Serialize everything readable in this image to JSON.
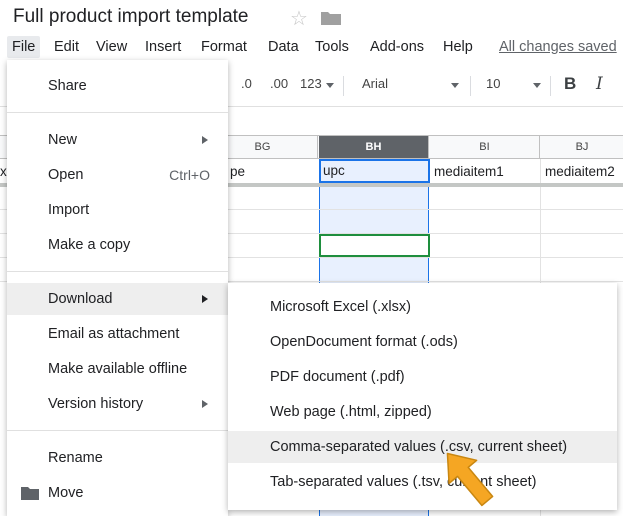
{
  "document": {
    "title": "Full product import template"
  },
  "menubar": {
    "items": [
      "File",
      "Edit",
      "View",
      "Insert",
      "Format",
      "Data",
      "Tools",
      "Add-ons",
      "Help"
    ],
    "save_status": "All changes saved"
  },
  "toolbar": {
    "decrease_decimal": ".0",
    "increase_decimal": ".00",
    "more_formats": "123",
    "font": "Arial",
    "font_size": "10",
    "bold": "B",
    "italic": "I"
  },
  "grid": {
    "columns": [
      {
        "letter": "BG",
        "selected": false
      },
      {
        "letter": "BH",
        "selected": true
      },
      {
        "letter": "BI",
        "selected": false
      },
      {
        "letter": "BJ",
        "selected": false
      }
    ],
    "header_row": {
      "bf_fragment": "x",
      "bg": "pe",
      "bh": "upc",
      "bi": "mediaitem1",
      "bj": "mediaitem2"
    },
    "selection_color": "#1a73e8",
    "active_cell_color": "#1e8e3e"
  },
  "file_menu": {
    "share": "Share",
    "new": "New",
    "open": "Open",
    "open_shortcut": "Ctrl+O",
    "import": "Import",
    "make_copy": "Make a copy",
    "download": "Download",
    "email_attachment": "Email as attachment",
    "make_offline": "Make available offline",
    "version_history": "Version history",
    "rename": "Rename",
    "move": "Move"
  },
  "download_menu": {
    "items": [
      "Microsoft Excel (.xlsx)",
      "OpenDocument format (.ods)",
      "PDF document (.pdf)",
      "Web page (.html, zipped)",
      "Comma-separated values (.csv, current sheet)",
      "Tab-separated values (.tsv, current sheet)"
    ],
    "highlighted_index": 4
  },
  "annotation": {
    "arrow_color": "#f5a623"
  }
}
